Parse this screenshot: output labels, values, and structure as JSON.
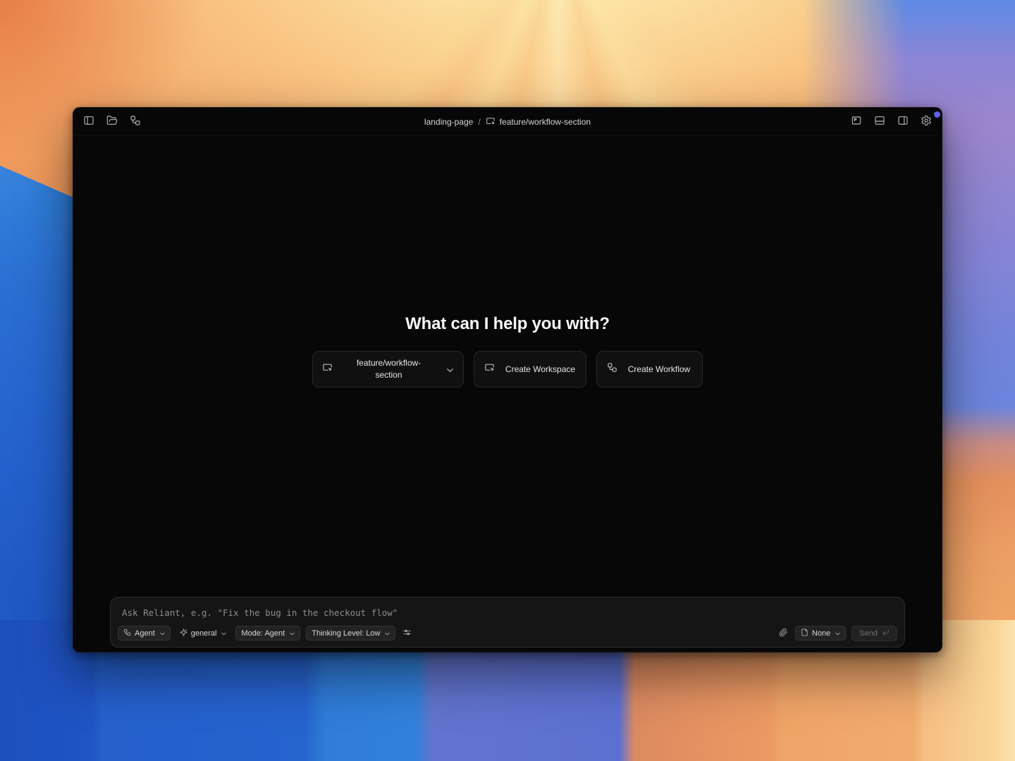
{
  "window": {
    "titlebar": {
      "project": "landing-page",
      "separator": "/",
      "branch": "feature/workflow-section",
      "left_icons": [
        "panel-left-icon",
        "folder-open-icon",
        "workflow-icon"
      ],
      "branch_icon": "workspace-icon",
      "right_icons": [
        "flag-square-icon",
        "panel-bottom-icon",
        "panel-right-icon",
        "settings-gear-icon"
      ],
      "notification_dot_color": "#5f62e0"
    },
    "main": {
      "heading": "What can I help you with?",
      "workspace_button": {
        "label": "feature/workflow-section",
        "icon": "workspace-icon",
        "has_chevron": true
      },
      "create_workspace_button": {
        "label": "Create Workspace",
        "icon": "workspace-icon"
      },
      "create_workflow_button": {
        "label": "Create Workflow",
        "icon": "workflow-icon"
      }
    },
    "composer": {
      "placeholder": "Ask Reliant, e.g. \"Fix the bug in the checkout flow\"",
      "agent_chip": {
        "label": "Agent",
        "icon": "workflow-icon",
        "has_chevron": true
      },
      "model_chip": {
        "label": "general",
        "icon": "sparkles-icon",
        "has_chevron": true
      },
      "mode_chip": {
        "label": "Mode: Agent",
        "has_chevron": true
      },
      "thinking_chip": {
        "label": "Thinking Level: Low",
        "has_chevron": true
      },
      "sliders_icon": "sliders-icon",
      "attach_icon": "paperclip-icon",
      "attachment_chip": {
        "label": "None",
        "icon": "file-icon",
        "has_chevron": true
      },
      "send_button": {
        "label": "Send",
        "icon": "return-key-icon",
        "state": "disabled"
      }
    }
  },
  "colors": {
    "window_bg": "#070707",
    "composer_bg": "#151515",
    "chip_bg": "#232323",
    "accent_dot": "#5f62e0"
  }
}
